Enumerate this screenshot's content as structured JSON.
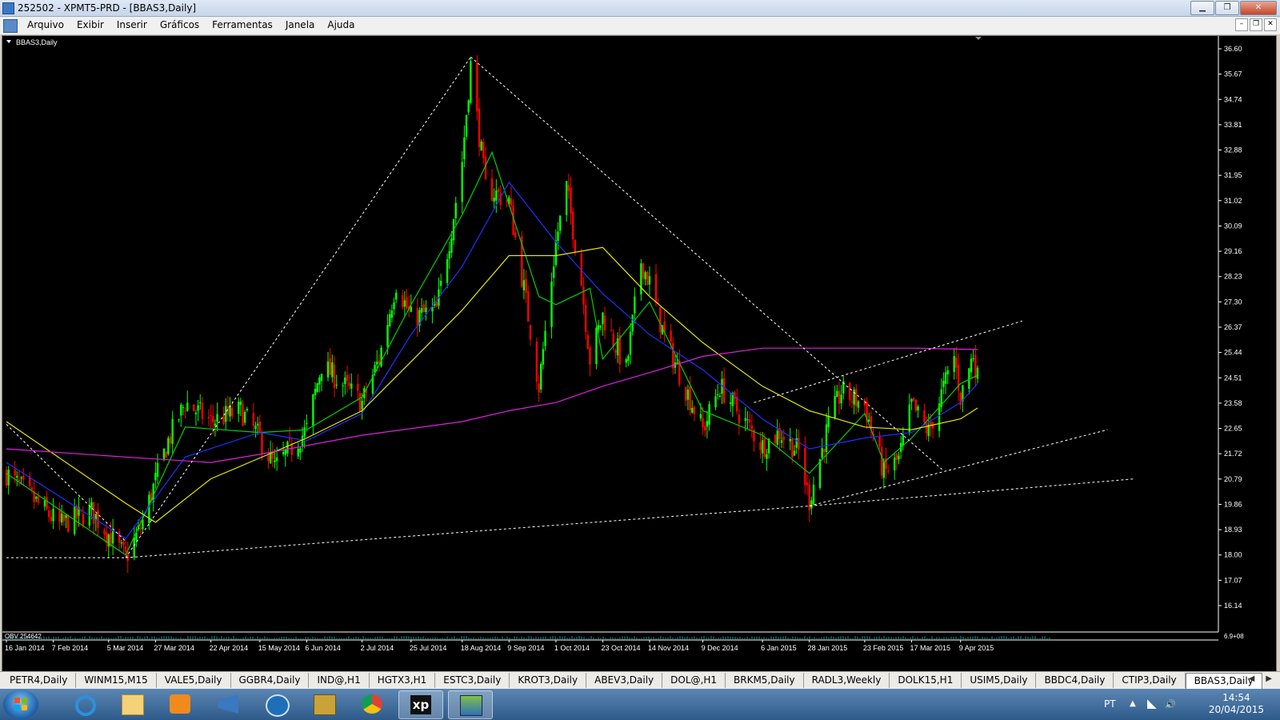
{
  "window": {
    "title": "252502 - XPMT5-PRD - [BBAS3,Daily]"
  },
  "menu": {
    "items": [
      "Arquivo",
      "Exibir",
      "Inserir",
      "Gráficos",
      "Ferramentas",
      "Janela",
      "Ajuda"
    ]
  },
  "chart": {
    "label": "BBAS3,Daily",
    "indicator_label": "OBV 254642",
    "indicator_value": "6.9+08",
    "price_levels": [
      "36.60",
      "35.67",
      "34.74",
      "33.81",
      "32.88",
      "31.95",
      "31.02",
      "30.09",
      "29.16",
      "28.23",
      "27.30",
      "26.37",
      "25.44",
      "24.51",
      "23.58",
      "22.65",
      "21.72",
      "20.79",
      "19.86",
      "18.93",
      "18.00",
      "17.07",
      "16.14"
    ],
    "date_labels": [
      "16 Jan 2014",
      "7 Feb 2014",
      "5 Mar 2014",
      "27 Mar 2014",
      "22 Apr 2014",
      "15 May 2014",
      "6 Jun 2014",
      "2 Jul 2014",
      "25 Jul 2014",
      "18 Aug 2014",
      "9 Sep 2014",
      "1 Oct 2014",
      "23 Oct 2014",
      "14 Nov 2014",
      "9 Dec 2014",
      "6 Jan 2015",
      "28 Jan 2015",
      "23 Feb 2015",
      "17 Mar 2015",
      "9 Apr 2015"
    ],
    "colors": {
      "background": "#000000",
      "up_candle": "#00ff00",
      "down_candle": "#ff0000",
      "ma_fast": "#00d000",
      "ma_mid": "#2030ff",
      "ma_slow": "#e8e800",
      "ma_long": "#e020e0",
      "trendline": "#ffffff",
      "axis_text": "#ffffff"
    }
  },
  "chart_data": {
    "type": "candlestick",
    "symbol": "BBAS3",
    "timeframe": "Daily",
    "ylim": [
      16.14,
      36.6
    ],
    "x_range": [
      "16 Jan 2014",
      "17 Apr 2015"
    ],
    "anchors": [
      [
        "16 Jan 2014",
        21.0
      ],
      [
        "10 Feb 2014",
        19.1
      ],
      [
        "25 Feb 2014",
        19.6
      ],
      [
        "13 Mar 2014",
        17.9
      ],
      [
        "20 Mar 2014",
        19.0
      ],
      [
        "2 Apr 2014",
        22.2
      ],
      [
        "10 Apr 2014",
        23.6
      ],
      [
        "22 Apr 2014",
        22.9
      ],
      [
        "6 May 2014",
        23.3
      ],
      [
        "15 May 2014",
        22.3
      ],
      [
        "22 May 2014",
        21.2
      ],
      [
        "6 Jun 2014",
        22.6
      ],
      [
        "13 Jun 2014",
        25.0
      ],
      [
        "2 Jul 2014",
        23.6
      ],
      [
        "10 Jul 2014",
        25.2
      ],
      [
        "18 Jul 2014",
        28.0
      ],
      [
        "25 Jul 2014",
        26.7
      ],
      [
        "6 Aug 2014",
        27.0
      ],
      [
        "13 Aug 2014",
        30.0
      ],
      [
        "18 Aug 2014",
        32.5
      ],
      [
        "22 Aug 2014",
        36.0
      ],
      [
        "29 Aug 2014",
        31.5
      ],
      [
        "9 Sep 2014",
        31.0
      ],
      [
        "16 Sep 2014",
        27.8
      ],
      [
        "23 Sep 2014",
        24.2
      ],
      [
        "1 Oct 2014",
        29.5
      ],
      [
        "6 Oct 2014",
        31.5
      ],
      [
        "13 Oct 2014",
        28.0
      ],
      [
        "17 Oct 2014",
        25.2
      ],
      [
        "23 Oct 2014",
        26.8
      ],
      [
        "3 Nov 2014",
        24.8
      ],
      [
        "10 Nov 2014",
        28.8
      ],
      [
        "14 Nov 2014",
        28.0
      ],
      [
        "21 Nov 2014",
        26.0
      ],
      [
        "9 Dec 2014",
        22.6
      ],
      [
        "17 Dec 2014",
        24.2
      ],
      [
        "6 Jan 2015",
        22.0
      ],
      [
        "14 Jan 2015",
        22.5
      ],
      [
        "23 Jan 2015",
        21.8
      ],
      [
        "28 Jan 2015",
        20.0
      ],
      [
        "6 Feb 2015",
        22.8
      ],
      [
        "12 Feb 2015",
        24.0
      ],
      [
        "23 Feb 2015",
        23.5
      ],
      [
        "4 Mar 2015",
        21.0
      ],
      [
        "11 Mar 2015",
        21.5
      ],
      [
        "17 Mar 2015",
        23.5
      ],
      [
        "25 Mar 2015",
        22.5
      ],
      [
        "6 Apr 2015",
        25.3
      ],
      [
        "9 Apr 2015",
        23.8
      ],
      [
        "15 Apr 2015",
        25.4
      ],
      [
        "17 Apr 2015",
        24.5
      ]
    ],
    "moving_averages": [
      {
        "color": "#00d000",
        "values": [
          [
            "16 Jan 2014",
            21.0
          ],
          [
            "13 Mar 2014",
            18.0
          ],
          [
            "10 Apr 2014",
            22.7
          ],
          [
            "15 May 2014",
            22.5
          ],
          [
            "6 Jun 2014",
            22.6
          ],
          [
            "2 Jul 2014",
            23.8
          ],
          [
            "25 Jul 2014",
            27.2
          ],
          [
            "18 Aug 2014",
            30.5
          ],
          [
            "1 Sep 2014",
            32.8
          ],
          [
            "23 Sep 2014",
            27.5
          ],
          [
            "1 Oct 2014",
            27.2
          ],
          [
            "17 Oct 2014",
            27.8
          ],
          [
            "23 Oct 2014",
            25.2
          ],
          [
            "14 Nov 2014",
            27.3
          ],
          [
            "9 Dec 2014",
            23.3
          ],
          [
            "6 Jan 2015",
            22.4
          ],
          [
            "28 Jan 2015",
            21.0
          ],
          [
            "23 Feb 2015",
            23.2
          ],
          [
            "4 Mar 2015",
            21.4
          ],
          [
            "17 Mar 2015",
            22.3
          ],
          [
            "9 Apr 2015",
            24.3
          ],
          [
            "17 Apr 2015",
            24.6
          ]
        ]
      },
      {
        "color": "#2030ff",
        "values": [
          [
            "16 Jan 2014",
            21.4
          ],
          [
            "13 Mar 2014",
            18.6
          ],
          [
            "10 Apr 2014",
            21.6
          ],
          [
            "15 May 2014",
            22.5
          ],
          [
            "6 Jun 2014",
            22.2
          ],
          [
            "2 Jul 2014",
            23.2
          ],
          [
            "25 Jul 2014",
            26.1
          ],
          [
            "18 Aug 2014",
            28.6
          ],
          [
            "9 Sep 2014",
            31.7
          ],
          [
            "1 Oct 2014",
            29.5
          ],
          [
            "23 Oct 2014",
            27.6
          ],
          [
            "14 Nov 2014",
            26.1
          ],
          [
            "9 Dec 2014",
            24.8
          ],
          [
            "6 Jan 2015",
            23.0
          ],
          [
            "28 Jan 2015",
            21.9
          ],
          [
            "23 Feb 2015",
            22.3
          ],
          [
            "17 Mar 2015",
            22.5
          ],
          [
            "9 Apr 2015",
            23.6
          ],
          [
            "17 Apr 2015",
            24.3
          ]
        ]
      },
      {
        "color": "#e8e800",
        "values": [
          [
            "16 Jan 2014",
            22.9
          ],
          [
            "13 Mar 2014",
            19.9
          ],
          [
            "27 Mar 2014",
            19.2
          ],
          [
            "22 Apr 2014",
            20.8
          ],
          [
            "6 Jun 2014",
            22.3
          ],
          [
            "2 Jul 2014",
            23.3
          ],
          [
            "25 Jul 2014",
            25.1
          ],
          [
            "18 Aug 2014",
            27.0
          ],
          [
            "9 Sep 2014",
            29.0
          ],
          [
            "1 Oct 2014",
            29.0
          ],
          [
            "23 Oct 2014",
            29.3
          ],
          [
            "14 Nov 2014",
            27.5
          ],
          [
            "9 Dec 2014",
            25.8
          ],
          [
            "6 Jan 2015",
            24.2
          ],
          [
            "28 Jan 2015",
            23.3
          ],
          [
            "23 Feb 2015",
            22.7
          ],
          [
            "17 Mar 2015",
            22.6
          ],
          [
            "9 Apr 2015",
            23.0
          ],
          [
            "17 Apr 2015",
            23.4
          ]
        ]
      },
      {
        "color": "#e020e0",
        "values": [
          [
            "16 Jan 2014",
            21.9
          ],
          [
            "13 Mar 2014",
            21.6
          ],
          [
            "22 Apr 2014",
            21.4
          ],
          [
            "15 May 2014",
            21.7
          ],
          [
            "2 Jul 2014",
            22.4
          ],
          [
            "18 Aug 2014",
            22.9
          ],
          [
            "9 Sep 2014",
            23.3
          ],
          [
            "1 Oct 2014",
            23.6
          ],
          [
            "23 Oct 2014",
            24.2
          ],
          [
            "14 Nov 2014",
            24.7
          ],
          [
            "9 Dec 2014",
            25.3
          ],
          [
            "6 Jan 2015",
            25.6
          ],
          [
            "23 Feb 2015",
            25.6
          ],
          [
            "17 Mar 2015",
            25.6
          ],
          [
            "17 Apr 2015",
            25.55
          ]
        ]
      }
    ],
    "trendlines": [
      [
        [
          "16 Jan 2014",
          22.8
        ],
        [
          "13 Mar 2014",
          18.5
        ]
      ],
      [
        [
          "13 Mar 2014",
          17.9
        ],
        [
          "22 Aug 2014",
          36.3
        ]
      ],
      [
        [
          "22 Aug 2014",
          36.3
        ],
        [
          "1 Apr 2015",
          21.1
        ]
      ],
      [
        [
          "16 Jan 2014",
          17.9
        ],
        [
          "13 Mar 2014",
          17.9
        ]
      ],
      [
        [
          "13 Mar 2014",
          17.9
        ],
        [
          "28 Jan 2015",
          19.8
        ],
        [
          "30 Jun 2015",
          20.8
        ]
      ],
      [
        [
          "28 Jan 2015",
          19.8
        ],
        [
          "17 Jun 2015",
          22.6
        ]
      ],
      [
        [
          "2 Jan 2015",
          23.6
        ],
        [
          "8 May 2015",
          26.6
        ]
      ]
    ]
  },
  "tabs": [
    "PETR4,Daily",
    "WINM15,M15",
    "VALE5,Daily",
    "GGBR4,Daily",
    "IND@,H1",
    "HGTX3,H1",
    "ESTC3,Daily",
    "KROT3,Daily",
    "ABEV3,Daily",
    "DOL@,H1",
    "BRKM5,Daily",
    "RADL3,Weekly",
    "DOLK15,H1",
    "USIM5,Daily",
    "BBDC4,Daily",
    "CTIP3,Daily",
    "BBAS3,Daily"
  ],
  "active_tab": "BBAS3,Daily",
  "taskbar": {
    "apps": [
      "windows-explorer-icon",
      "internet-explorer-icon",
      "folder-icon",
      "media-player-icon",
      "network-icon",
      "hp-icon",
      "archive-icon",
      "chrome-icon",
      "xp-icon",
      "metatrader-icon"
    ],
    "xp_label": "xp",
    "language": "PT",
    "time": "14:54",
    "date": "20/04/2015"
  }
}
